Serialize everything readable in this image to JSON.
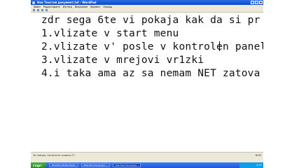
{
  "window": {
    "title": "Нов Текстов документ.txt - WordPad",
    "buttons": [
      "minimize",
      "maximize",
      "close"
    ]
  },
  "menu": [
    "Файл",
    "Редактиране",
    "Изглед",
    "Вмъкване",
    "Формат",
    "Помощ"
  ],
  "document": {
    "lines": [
      "zdr sega 6te vi pokaja kak da si pr",
      "1.vlizate v start menu",
      "2.vlizate v' posle v kontrolen panel",
      "3.vlizate v mrejovi vr1zki",
      "4.i taka ama az sa nemam NET zatova"
    ]
  },
  "status": {
    "hint": "За помощ, натиснете клавиш F1",
    "right": "NUM"
  },
  "taskbar": {
    "start_label": "старт",
    "tasks": [
      "Windows Media Player",
      "Нов Текстов докум...",
      "Нов Текстов докум..."
    ],
    "clock": "4:57"
  }
}
